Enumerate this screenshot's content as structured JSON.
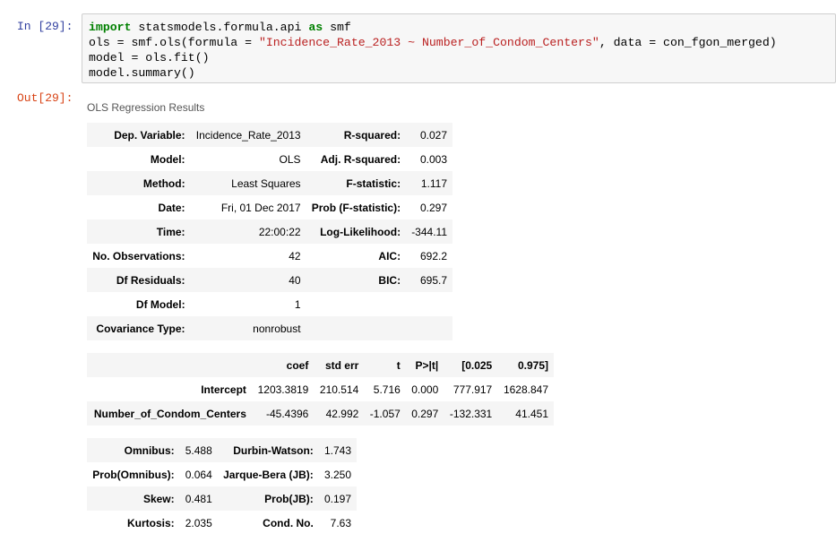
{
  "cell": {
    "in_prompt": "In [29]:",
    "out_prompt": "Out[29]:",
    "code": {
      "l1_kw": "import",
      "l1_mid": " statsmodels.formula.api ",
      "l1_kw2": "as",
      "l1_end": " smf",
      "l2_pre": "ols = smf.ols(formula = ",
      "l2_str": "\"Incidence_Rate_2013 ~ Number_of_Condom_Centers\"",
      "l2_post": ", data = con_fgon_merged)",
      "l3": "model = ols.fit()",
      "l4": "model.summary()"
    }
  },
  "summary": {
    "caption": "OLS Regression Results",
    "top": [
      [
        "Dep. Variable:",
        "Incidence_Rate_2013",
        "R-squared:",
        "0.027"
      ],
      [
        "Model:",
        "OLS",
        "Adj. R-squared:",
        "0.003"
      ],
      [
        "Method:",
        "Least Squares",
        "F-statistic:",
        "1.117"
      ],
      [
        "Date:",
        "Fri, 01 Dec 2017",
        "Prob (F-statistic):",
        "0.297"
      ],
      [
        "Time:",
        "22:00:22",
        "Log-Likelihood:",
        "-344.11"
      ],
      [
        "No. Observations:",
        "42",
        "AIC:",
        "692.2"
      ],
      [
        "Df Residuals:",
        "40",
        "BIC:",
        "695.7"
      ],
      [
        "Df Model:",
        "1",
        "",
        ""
      ],
      [
        "Covariance Type:",
        "nonrobust",
        "",
        ""
      ]
    ],
    "coef_header": [
      "",
      "coef",
      "std err",
      "t",
      "P>|t|",
      "[0.025",
      "0.975]"
    ],
    "coef_rows": [
      [
        "Intercept",
        "1203.3819",
        "210.514",
        "5.716",
        "0.000",
        "777.917",
        "1628.847"
      ],
      [
        "Number_of_Condom_Centers",
        "-45.4396",
        "42.992",
        "-1.057",
        "0.297",
        "-132.331",
        "41.451"
      ]
    ],
    "diag": [
      [
        "Omnibus:",
        "5.488",
        "Durbin-Watson:",
        "1.743"
      ],
      [
        "Prob(Omnibus):",
        "0.064",
        "Jarque-Bera (JB):",
        "3.250"
      ],
      [
        "Skew:",
        "0.481",
        "Prob(JB):",
        "0.197"
      ],
      [
        "Kurtosis:",
        "2.035",
        "Cond. No.",
        "7.63"
      ]
    ]
  }
}
